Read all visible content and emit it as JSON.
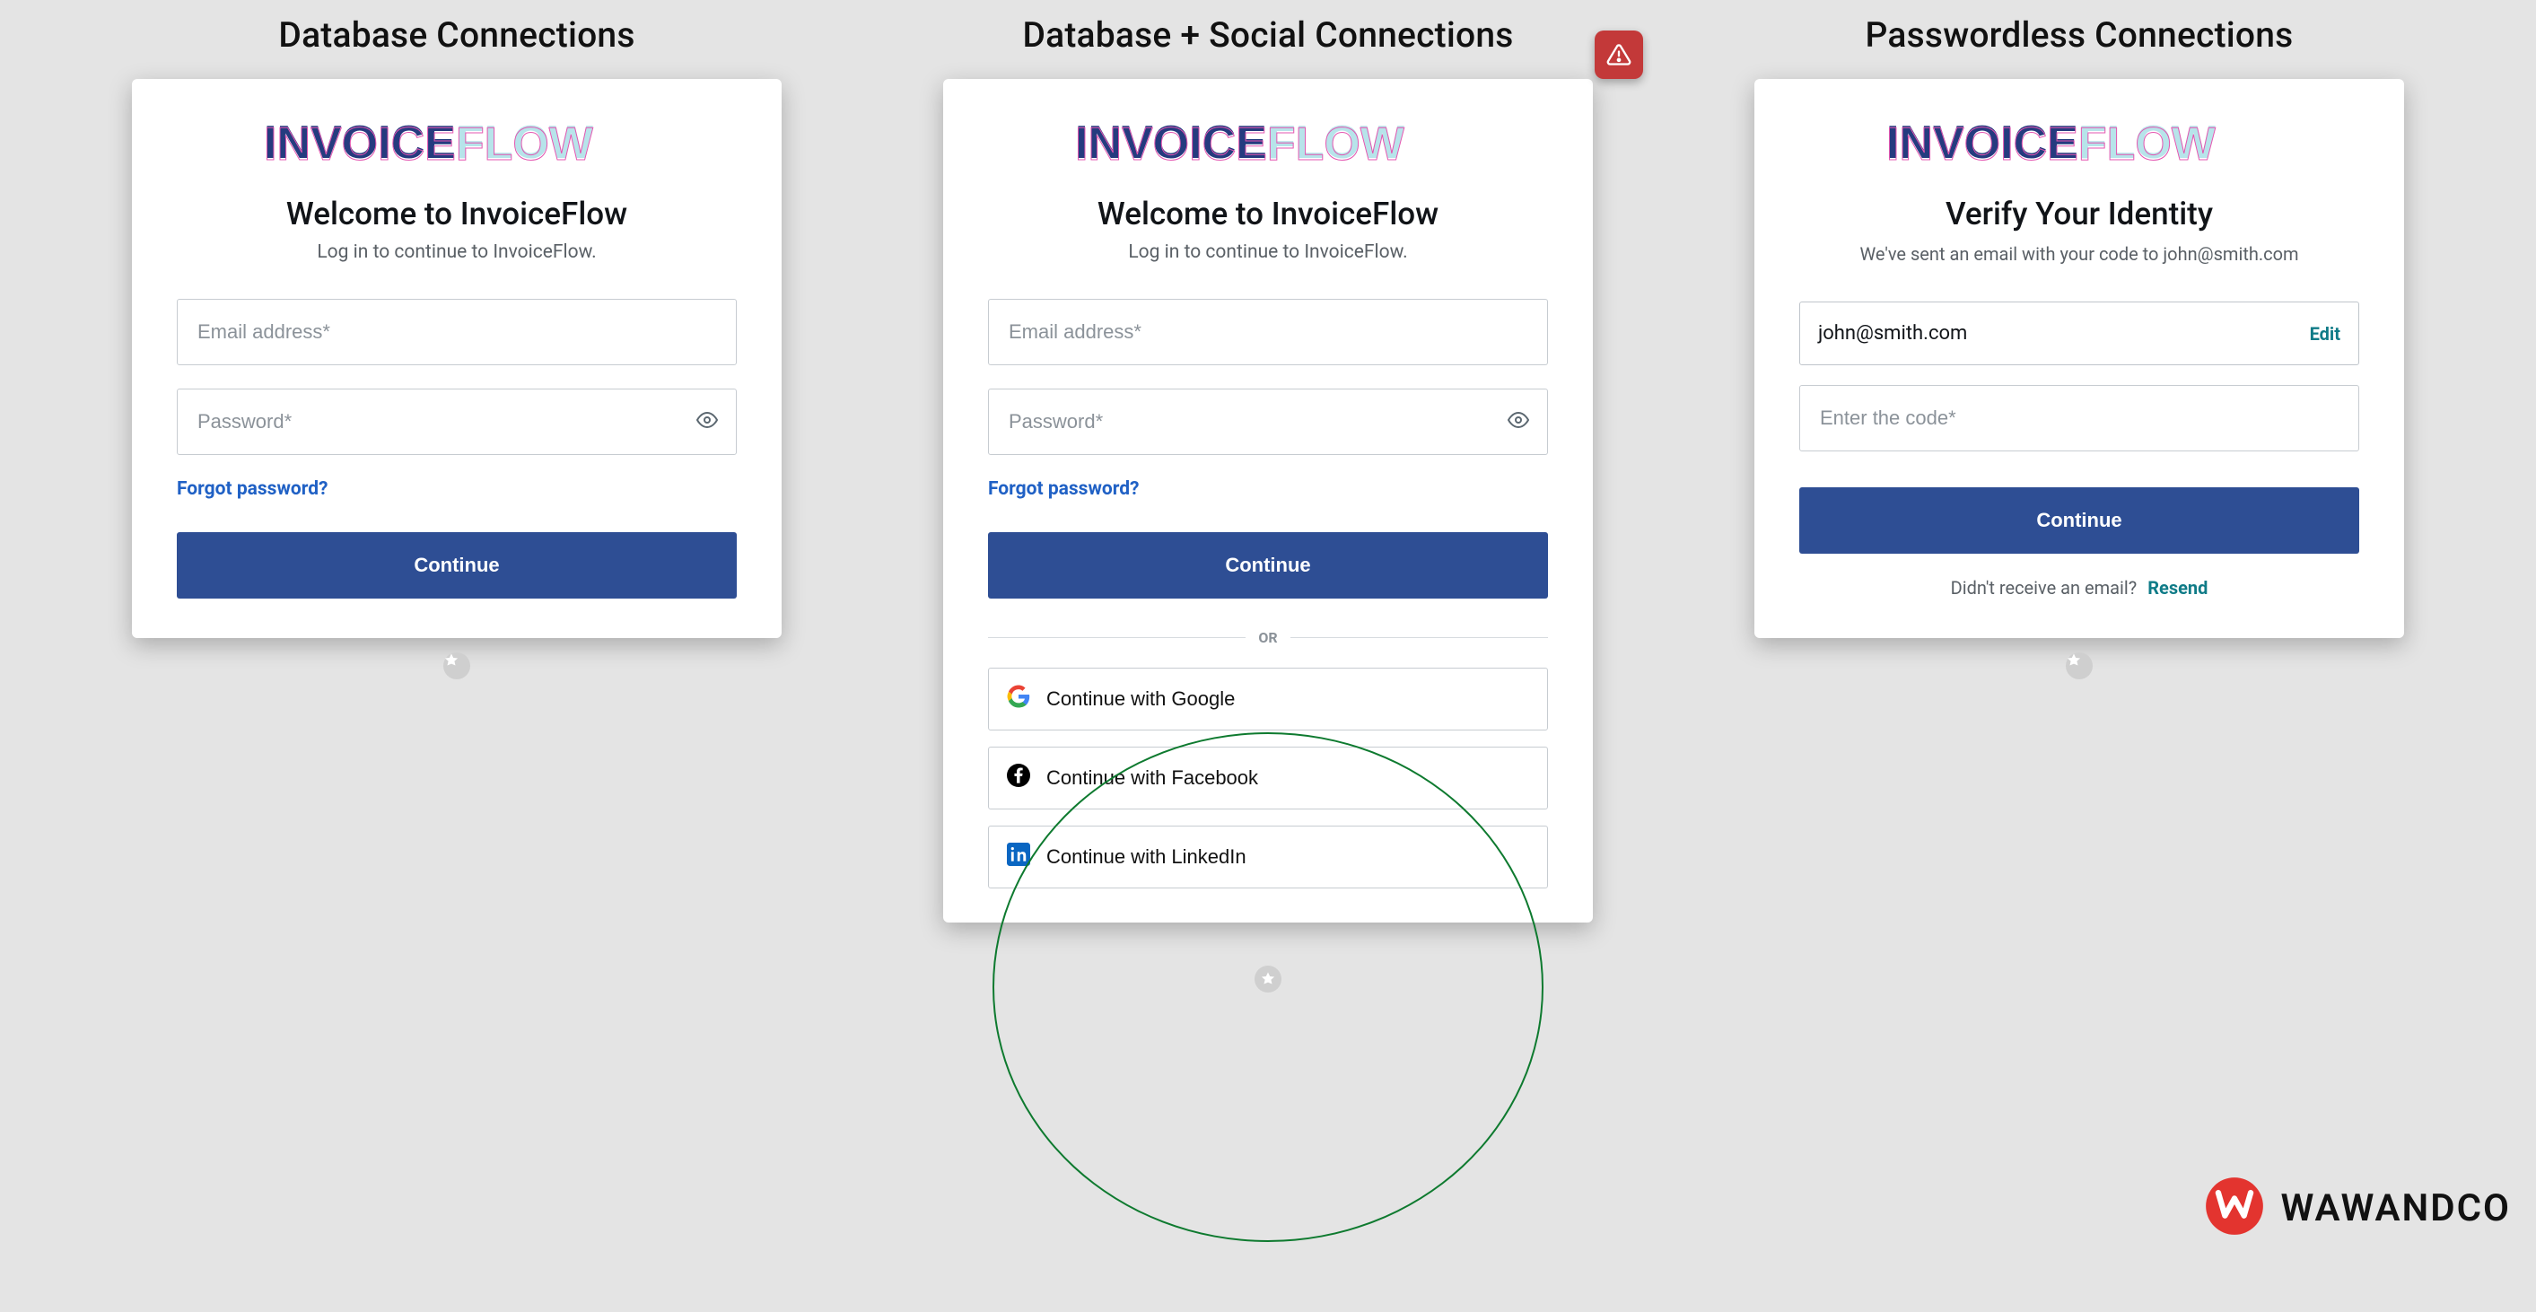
{
  "columns": {
    "left": {
      "title": "Database Connections"
    },
    "center": {
      "title": "Database + Social Connections"
    },
    "right": {
      "title": "Passwordless Connections"
    }
  },
  "logo_text": "INVOICEFLOW",
  "left_panel": {
    "welcome": "Welcome to InvoiceFlow",
    "subtitle": "Log in to continue to InvoiceFlow.",
    "email_placeholder": "Email address*",
    "password_placeholder": "Password*",
    "forgot": "Forgot password?",
    "continue": "Continue"
  },
  "center_panel": {
    "welcome": "Welcome to InvoiceFlow",
    "subtitle": "Log in to continue to InvoiceFlow.",
    "email_placeholder": "Email address*",
    "password_placeholder": "Password*",
    "forgot": "Forgot password?",
    "continue": "Continue",
    "or": "OR",
    "google": "Continue with Google",
    "facebook": "Continue with Facebook",
    "linkedin": "Continue with LinkedIn"
  },
  "right_panel": {
    "welcome": "Verify Your Identity",
    "subtitle": "We've sent an email with your code to john@smith.com",
    "email_value": "john@smith.com",
    "edit": "Edit",
    "code_placeholder": "Enter the code*",
    "continue": "Continue",
    "no_email": "Didn't receive an email?",
    "resend": "Resend"
  },
  "footer_brand": "WAWANDCO"
}
